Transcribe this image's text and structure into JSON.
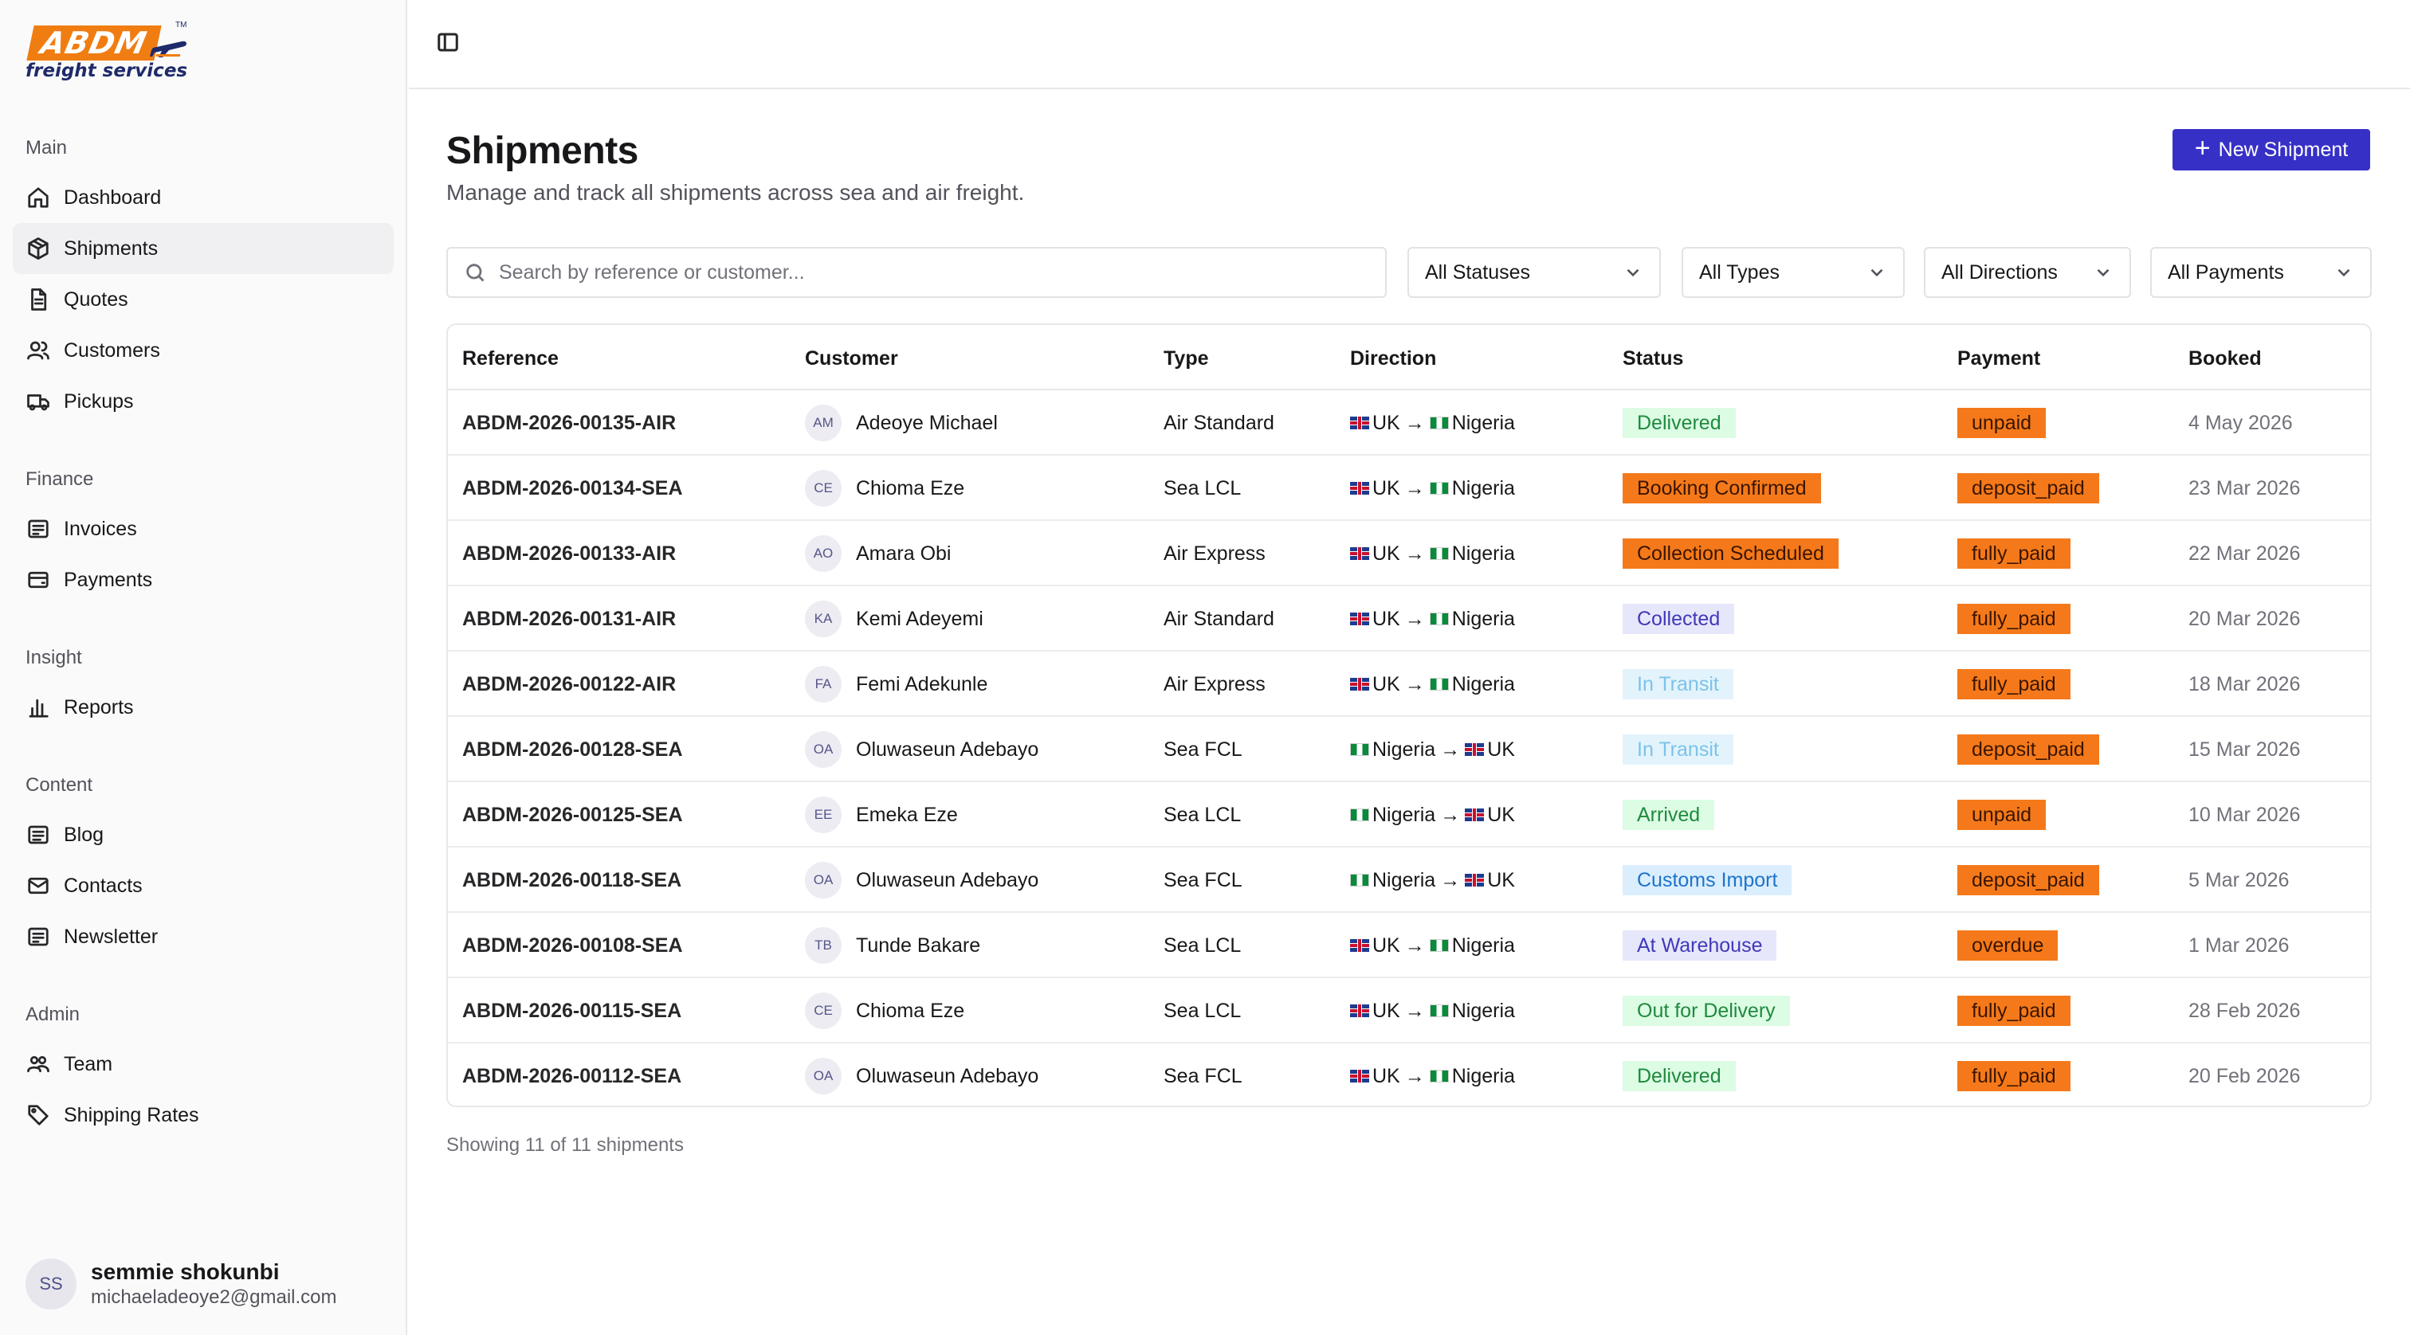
{
  "brand": {
    "logo_text": "ABDM",
    "logo_sub": "freight services",
    "logo_tm": "TM"
  },
  "sidebar": {
    "sections": [
      {
        "title": "Main",
        "items": [
          {
            "label": "Dashboard",
            "icon": "home-icon"
          },
          {
            "label": "Shipments",
            "icon": "package-icon",
            "active": true
          },
          {
            "label": "Quotes",
            "icon": "document-icon"
          },
          {
            "label": "Customers",
            "icon": "users-icon"
          },
          {
            "label": "Pickups",
            "icon": "truck-icon"
          }
        ]
      },
      {
        "title": "Finance",
        "items": [
          {
            "label": "Invoices",
            "icon": "receipt-icon"
          },
          {
            "label": "Payments",
            "icon": "wallet-icon"
          }
        ]
      },
      {
        "title": "Insight",
        "items": [
          {
            "label": "Reports",
            "icon": "bar-chart-icon"
          }
        ]
      },
      {
        "title": "Content",
        "items": [
          {
            "label": "Blog",
            "icon": "newspaper-icon"
          },
          {
            "label": "Contacts",
            "icon": "mail-icon"
          },
          {
            "label": "Newsletter",
            "icon": "newsletter-icon"
          }
        ]
      },
      {
        "title": "Admin",
        "items": [
          {
            "label": "Team",
            "icon": "team-icon"
          },
          {
            "label": "Shipping Rates",
            "icon": "tag-icon"
          }
        ]
      }
    ],
    "user": {
      "initials": "SS",
      "name": "semmie shokunbi",
      "email": "michaeladeoye2@gmail.com"
    }
  },
  "header": {
    "title": "Shipments",
    "subtitle": "Manage and track all shipments across sea and air freight.",
    "new_button": "New Shipment"
  },
  "filters": {
    "search_placeholder": "Search by reference or customer...",
    "status": "All Statuses",
    "type": "All Types",
    "direction": "All Directions",
    "payment": "All Payments"
  },
  "table": {
    "columns": [
      "Reference",
      "Customer",
      "Type",
      "Direction",
      "Status",
      "Payment",
      "Booked"
    ],
    "rows": [
      {
        "reference": "ABDM-2026-00135-AIR",
        "initials": "AM",
        "customer": "Adeoye Michael",
        "type": "Air Standard",
        "from": "UK",
        "to": "Nigeria",
        "status": "Delivered",
        "status_style": "green",
        "payment": "unpaid",
        "booked": "4 May 2026"
      },
      {
        "reference": "ABDM-2026-00134-SEA",
        "initials": "CE",
        "customer": "Chioma Eze",
        "type": "Sea LCL",
        "from": "UK",
        "to": "Nigeria",
        "status": "Booking Confirmed",
        "status_style": "orange",
        "payment": "deposit_paid",
        "booked": "23 Mar 2026"
      },
      {
        "reference": "ABDM-2026-00133-AIR",
        "initials": "AO",
        "customer": "Amara Obi",
        "type": "Air Express",
        "from": "UK",
        "to": "Nigeria",
        "status": "Collection Scheduled",
        "status_style": "orange",
        "payment": "fully_paid",
        "booked": "22 Mar 2026"
      },
      {
        "reference": "ABDM-2026-00131-AIR",
        "initials": "KA",
        "customer": "Kemi Adeyemi",
        "type": "Air Standard",
        "from": "UK",
        "to": "Nigeria",
        "status": "Collected",
        "status_style": "purple",
        "payment": "fully_paid",
        "booked": "20 Mar 2026"
      },
      {
        "reference": "ABDM-2026-00122-AIR",
        "initials": "FA",
        "customer": "Femi Adekunle",
        "type": "Air Express",
        "from": "UK",
        "to": "Nigeria",
        "status": "In Transit",
        "status_style": "sky",
        "payment": "fully_paid",
        "booked": "18 Mar 2026"
      },
      {
        "reference": "ABDM-2026-00128-SEA",
        "initials": "OA",
        "customer": "Oluwaseun Adebayo",
        "type": "Sea FCL",
        "from": "Nigeria",
        "to": "UK",
        "status": "In Transit",
        "status_style": "sky",
        "payment": "deposit_paid",
        "booked": "15 Mar 2026"
      },
      {
        "reference": "ABDM-2026-00125-SEA",
        "initials": "EE",
        "customer": "Emeka Eze",
        "type": "Sea LCL",
        "from": "Nigeria",
        "to": "UK",
        "status": "Arrived",
        "status_style": "green",
        "payment": "unpaid",
        "booked": "10 Mar 2026"
      },
      {
        "reference": "ABDM-2026-00118-SEA",
        "initials": "OA",
        "customer": "Oluwaseun Adebayo",
        "type": "Sea FCL",
        "from": "Nigeria",
        "to": "UK",
        "status": "Customs Import",
        "status_style": "blue",
        "payment": "deposit_paid",
        "booked": "5 Mar 2026"
      },
      {
        "reference": "ABDM-2026-00108-SEA",
        "initials": "TB",
        "customer": "Tunde Bakare",
        "type": "Sea LCL",
        "from": "UK",
        "to": "Nigeria",
        "status": "At Warehouse",
        "status_style": "purple",
        "payment": "overdue",
        "booked": "1 Mar 2026"
      },
      {
        "reference": "ABDM-2026-00115-SEA",
        "initials": "CE",
        "customer": "Chioma Eze",
        "type": "Sea LCL",
        "from": "UK",
        "to": "Nigeria",
        "status": "Out for Delivery",
        "status_style": "green",
        "payment": "fully_paid",
        "booked": "28 Feb 2026"
      },
      {
        "reference": "ABDM-2026-00112-SEA",
        "initials": "OA",
        "customer": "Oluwaseun Adebayo",
        "type": "Sea FCL",
        "from": "UK",
        "to": "Nigeria",
        "status": "Delivered",
        "status_style": "green",
        "payment": "fully_paid",
        "booked": "20 Feb 2026"
      }
    ],
    "footer": "Showing 11 of 11 shipments"
  },
  "colors": {
    "accent": "#3730c7",
    "brand_orange": "#f07d12",
    "brand_navy": "#1f2a6b"
  }
}
